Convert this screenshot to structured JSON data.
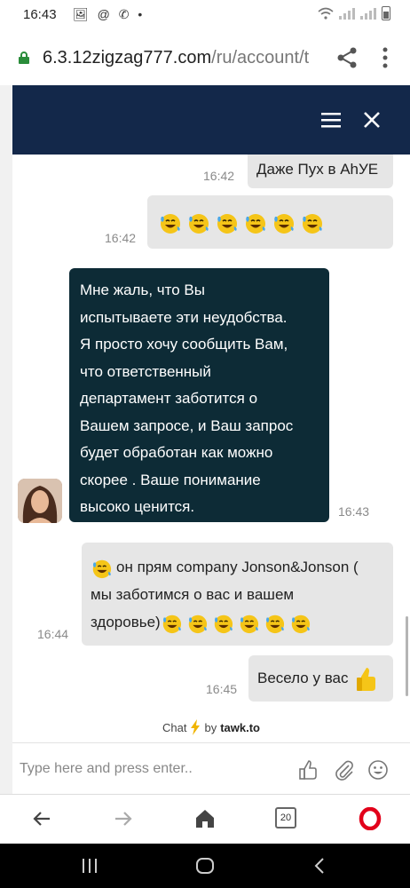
{
  "status": {
    "time": "16:43",
    "icons_left": "🖼 @ ✆ •"
  },
  "browser": {
    "url_host": "6.3.12zigzag777.com",
    "url_path": "/ru/account/t",
    "tabs_count": "20"
  },
  "chat": {
    "messages": [
      {
        "from": "visitor",
        "text": "Даже Пух в AhУЕ",
        "time": "16:42"
      },
      {
        "from": "visitor",
        "emoji_count": 6,
        "time": "16:42"
      },
      {
        "from": "agent",
        "lines": [
          "Мне жаль, что Вы",
          "испытываете эти неудобства.",
          "Я просто хочу сообщить Вам,",
          "что ответственный",
          "департамент заботится о",
          "Вашем запросе, и Ваш запрос",
          "будет обработан как можно",
          "скорее . Ваше понимание",
          "высоко ценится."
        ],
        "time": "16:43"
      },
      {
        "from": "visitor",
        "line1": "он прям company Jonson&Jonson (",
        "line2": "мы заботимся о вас и вашем",
        "line3": "здоровье)",
        "time": "16:44"
      },
      {
        "from": "visitor",
        "text": "Весело у вас",
        "time": "16:45"
      }
    ],
    "powered_chat": "Chat",
    "powered_by": "by",
    "powered_brand": "tawk.to",
    "composer_placeholder": "Type here and press enter.."
  },
  "colors": {
    "header": "#13284a",
    "agent_bubble": "#0d2b36",
    "visitor_bubble": "#e6e6e6"
  },
  "icons": [
    "lock-icon",
    "share-icon",
    "more-icon",
    "menu-icon",
    "close-icon",
    "laughing-emoji-icon",
    "thumbs-up-icon",
    "like-icon",
    "attach-icon",
    "emoji-icon",
    "back-icon",
    "forward-icon",
    "home-icon",
    "opera-icon"
  ]
}
